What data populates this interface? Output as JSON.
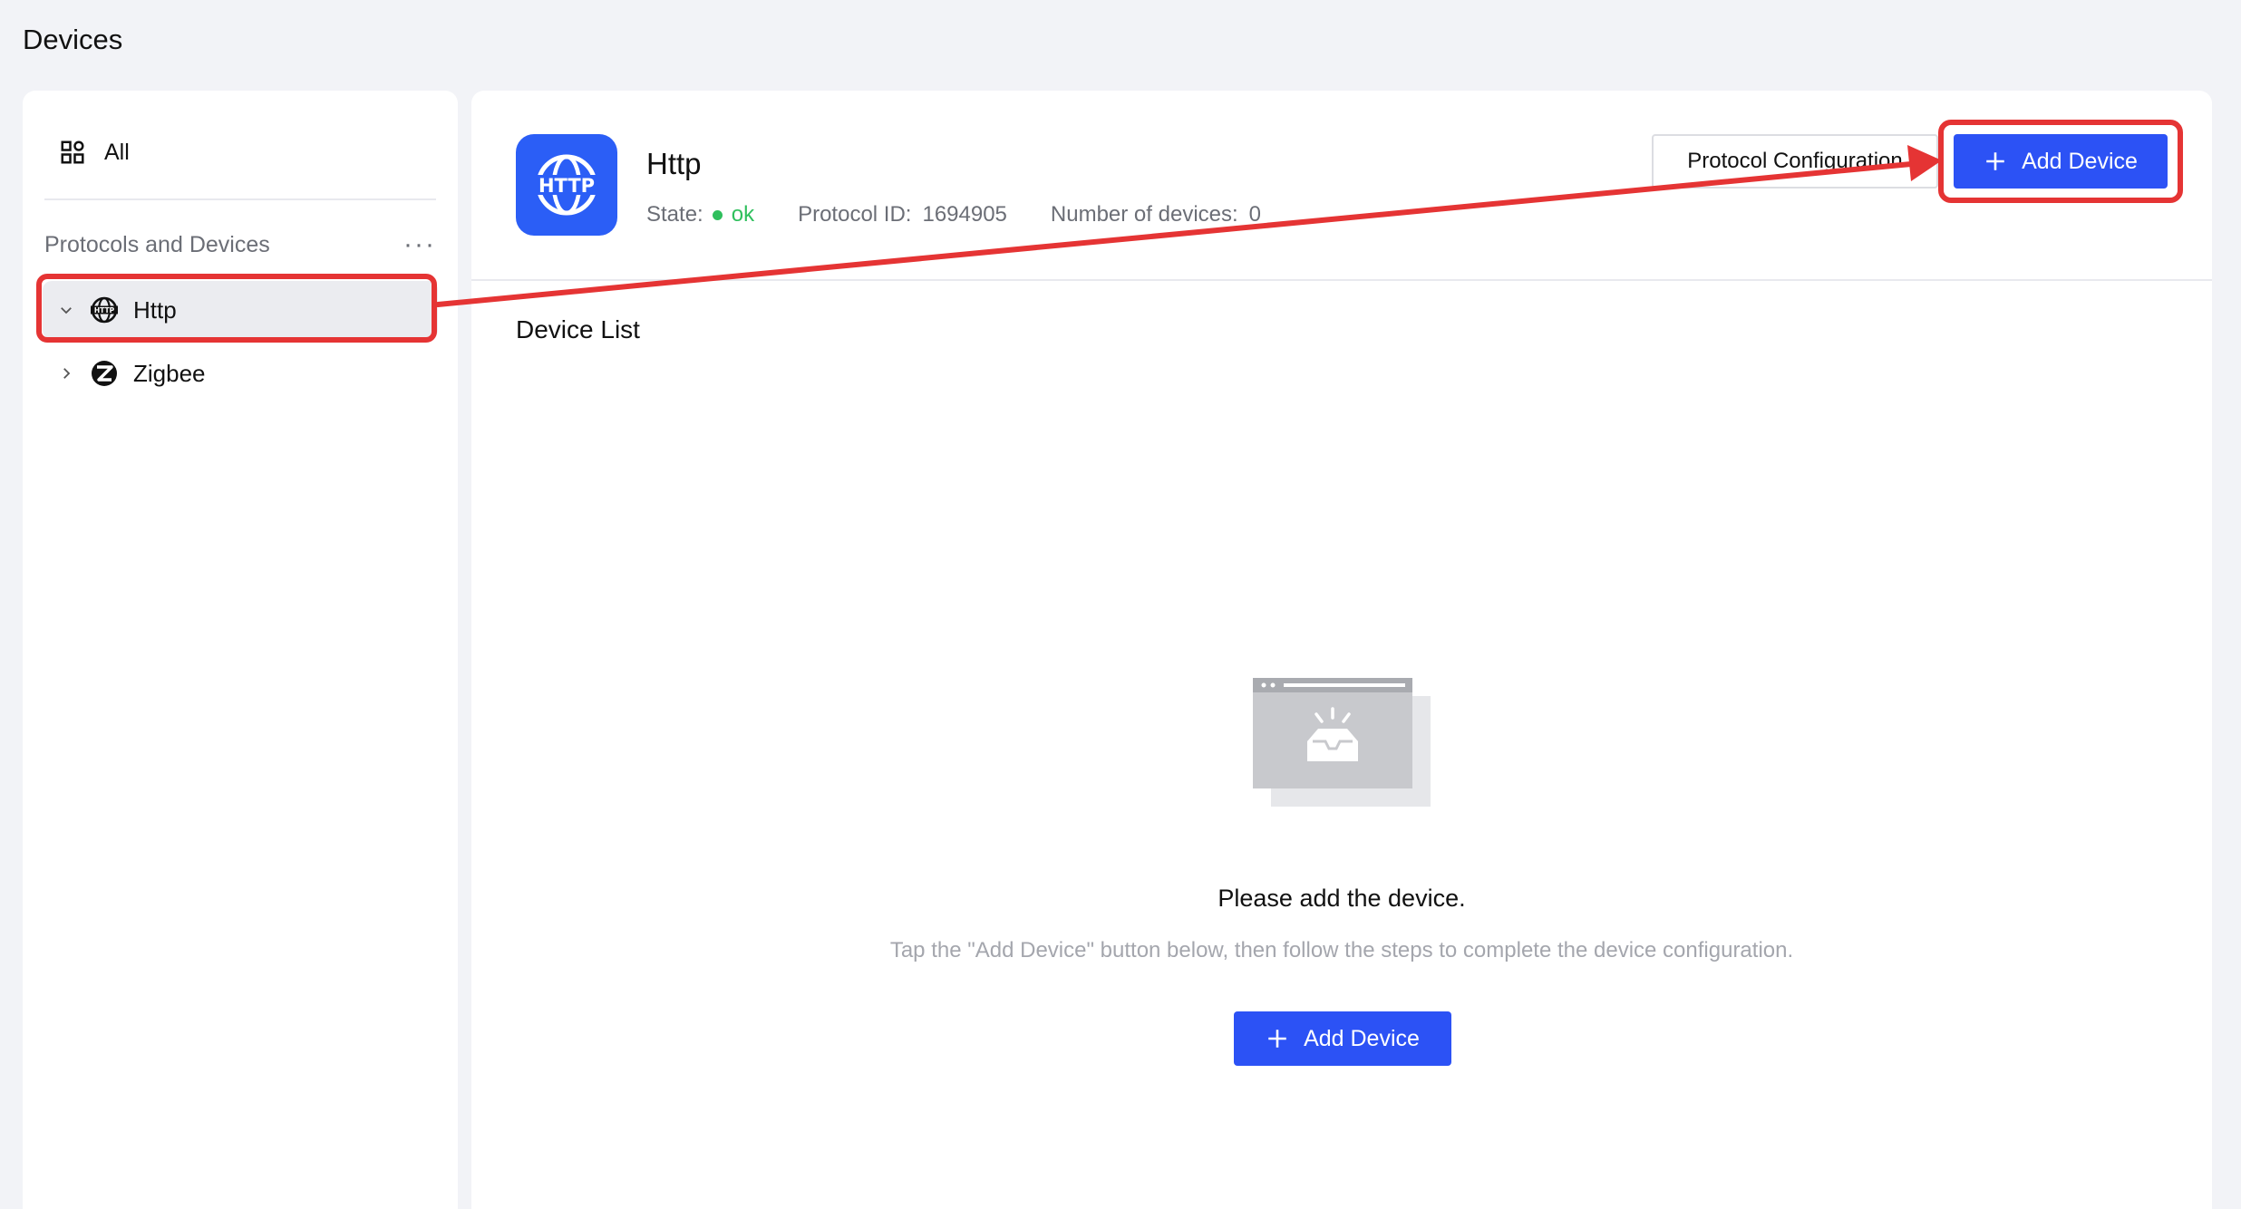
{
  "page": {
    "title": "Devices"
  },
  "sidebar": {
    "all_label": "All",
    "section_label": "Protocols and Devices",
    "more_label": "···",
    "protocols": [
      {
        "label": "Http",
        "expanded": true,
        "selected": true,
        "icon": "globe-http-icon"
      },
      {
        "label": "Zigbee",
        "expanded": false,
        "selected": false,
        "icon": "zigbee-icon"
      }
    ]
  },
  "protocol": {
    "logo_text": "HTTP",
    "name": "Http",
    "state_label": "State:",
    "state_value": "ok",
    "id_label": "Protocol ID:",
    "id_value": "1694905",
    "count_label": "Number of devices:",
    "count_value": "0"
  },
  "toolbar": {
    "config_label": "Protocol Configuration",
    "add_label": "Add Device"
  },
  "device_list": {
    "title": "Device List",
    "empty_title": "Please add the device.",
    "empty_desc": "Tap the \"Add Device\" button below, then follow the steps to complete the device configuration.",
    "add_label": "Add Device"
  },
  "colors": {
    "accent": "#2c52f5",
    "logo_bg": "#2b5ef6",
    "ok": "#2fbf5d",
    "annotation": "#e53434"
  }
}
